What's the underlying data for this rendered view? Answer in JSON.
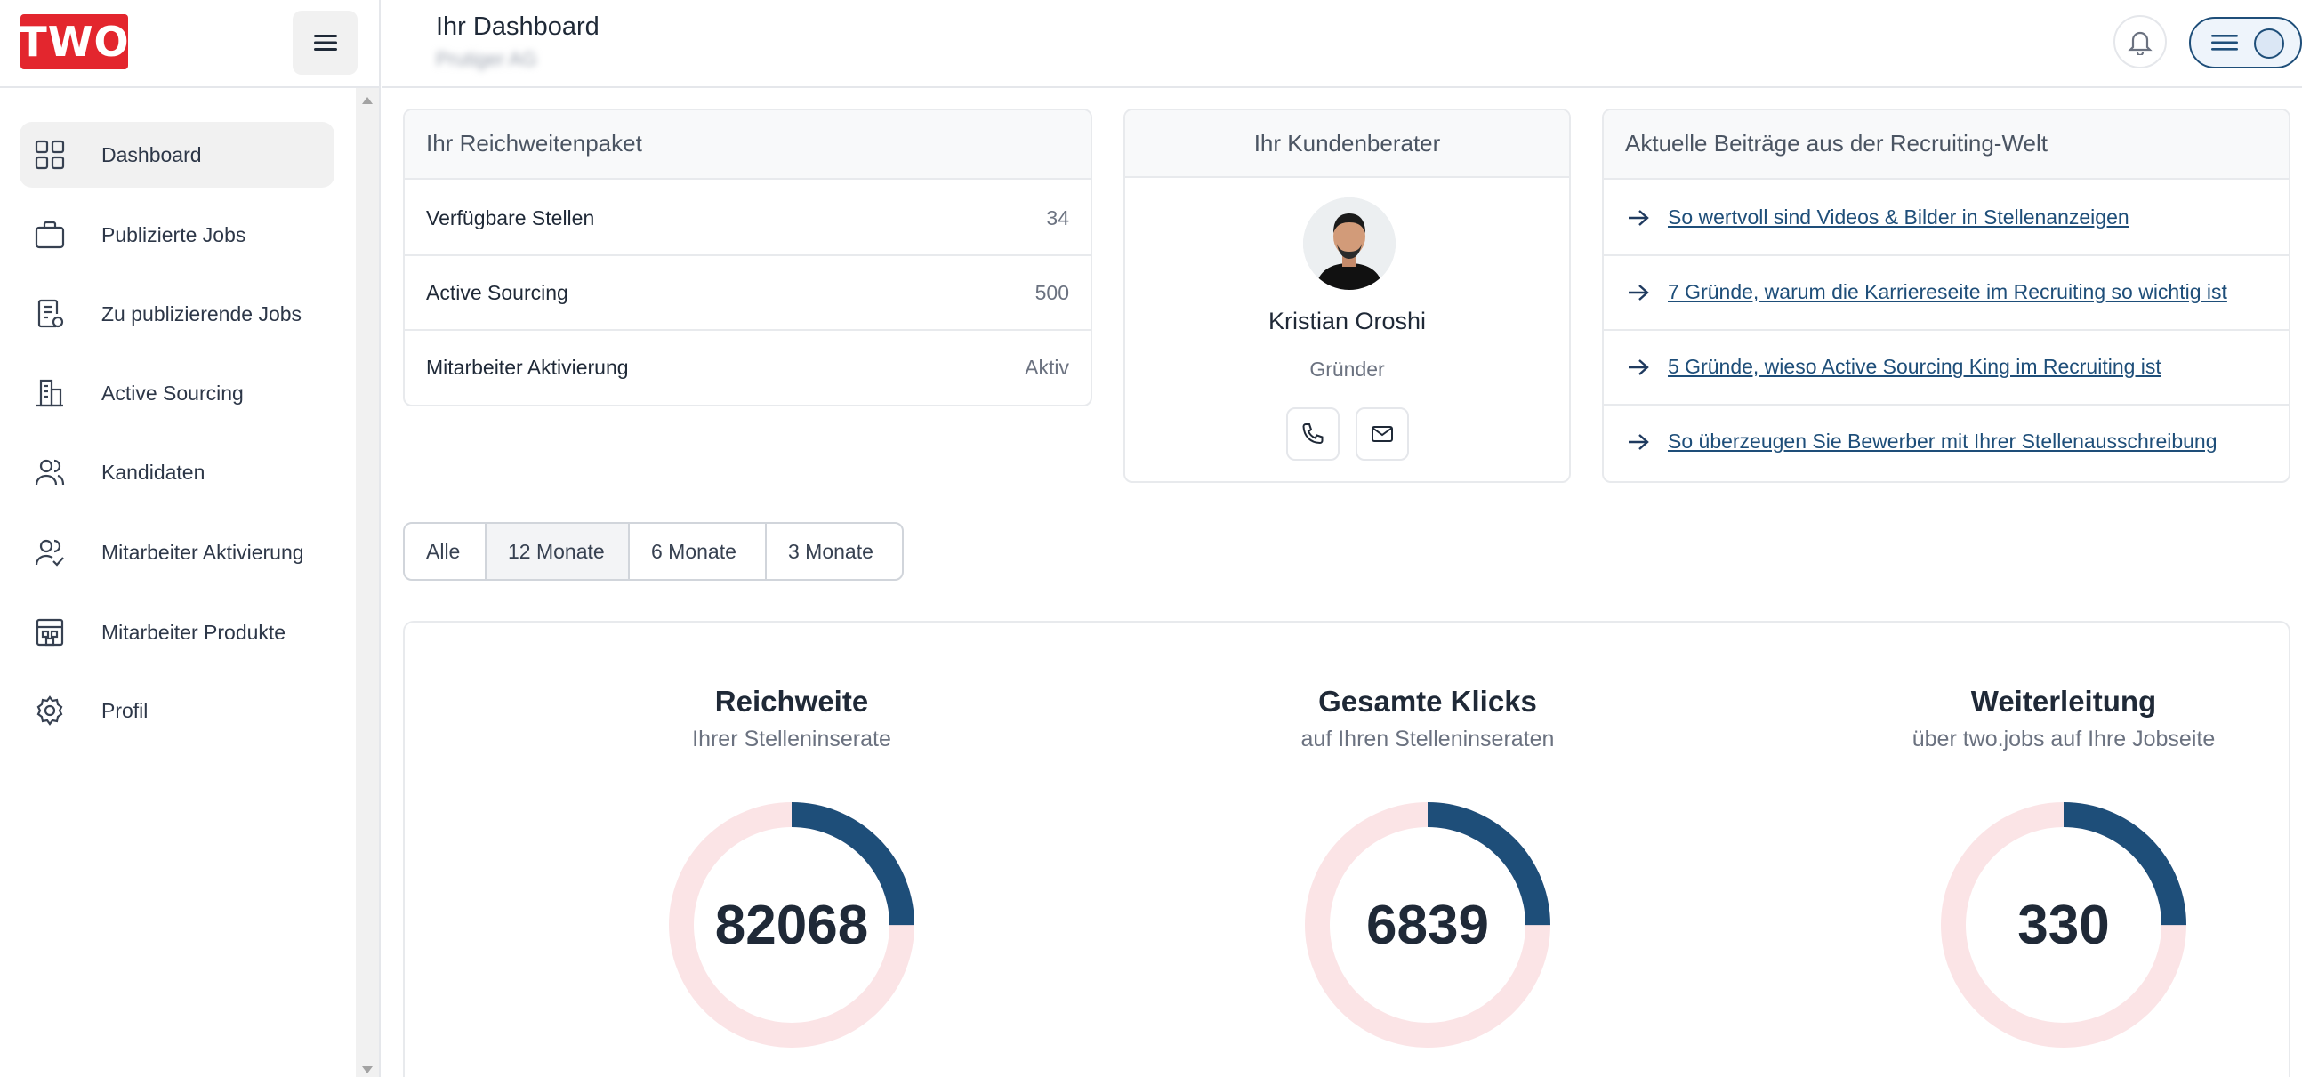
{
  "brand": {
    "logo_text": "TWO",
    "accent": "#e3262e",
    "primary": "#1e4e79"
  },
  "header": {
    "title": "Ihr Dashboard",
    "subtitle": "Prutiger AG"
  },
  "sidebar": {
    "items": [
      {
        "label": "Dashboard",
        "icon": "grid-icon",
        "active": true
      },
      {
        "label": "Publizierte Jobs",
        "icon": "briefcase-icon"
      },
      {
        "label": "Zu publizierende Jobs",
        "icon": "document-icon"
      },
      {
        "label": "Active Sourcing",
        "icon": "building-icon"
      },
      {
        "label": "Kandidaten",
        "icon": "users-icon"
      },
      {
        "label": "Mitarbeiter Aktivierung",
        "icon": "user-check-icon"
      },
      {
        "label": "Mitarbeiter Produkte",
        "icon": "store-icon"
      },
      {
        "label": "Profil",
        "icon": "gear-icon"
      }
    ]
  },
  "package": {
    "title": "Ihr Reichweitenpaket",
    "rows": [
      {
        "label": "Verfügbare Stellen",
        "value": "34"
      },
      {
        "label": "Active Sourcing",
        "value": "500"
      },
      {
        "label": "Mitarbeiter Aktivierung",
        "value": "Aktiv"
      }
    ]
  },
  "advisor": {
    "title": "Ihr Kundenberater",
    "name": "Kristian Oroshi",
    "role": "Gründer"
  },
  "articles": {
    "title": "Aktuelle Beiträge aus der Recruiting-Welt",
    "items": [
      "So wertvoll sind Videos & Bilder in Stellenanzeigen",
      "7 Gründe, warum die Karriereseite im Recruiting so wichtig ist",
      "5 Gründe, wieso Active Sourcing King im Recruiting ist",
      "So überzeugen Sie Bewerber mit Ihrer Stellenausschreibung"
    ]
  },
  "filter": {
    "options": [
      "Alle",
      "12 Monate",
      "6 Monate",
      "3 Monate"
    ],
    "selected": "12 Monate"
  },
  "stats": [
    {
      "title": "Reichweite",
      "subtitle": "Ihrer Stelleninserate",
      "value": "82068",
      "fill_fraction": 0.25
    },
    {
      "title": "Gesamte Klicks",
      "subtitle": "auf Ihren Stelleninseraten",
      "value": "6839",
      "fill_fraction": 0.25
    },
    {
      "title": "Weiterleitung",
      "subtitle": "über two.jobs auf Ihre Jobseite",
      "value": "330",
      "fill_fraction": 0.25
    }
  ],
  "colors": {
    "donut_fill": "#1e4e79",
    "donut_track": "#fbe4e6"
  }
}
